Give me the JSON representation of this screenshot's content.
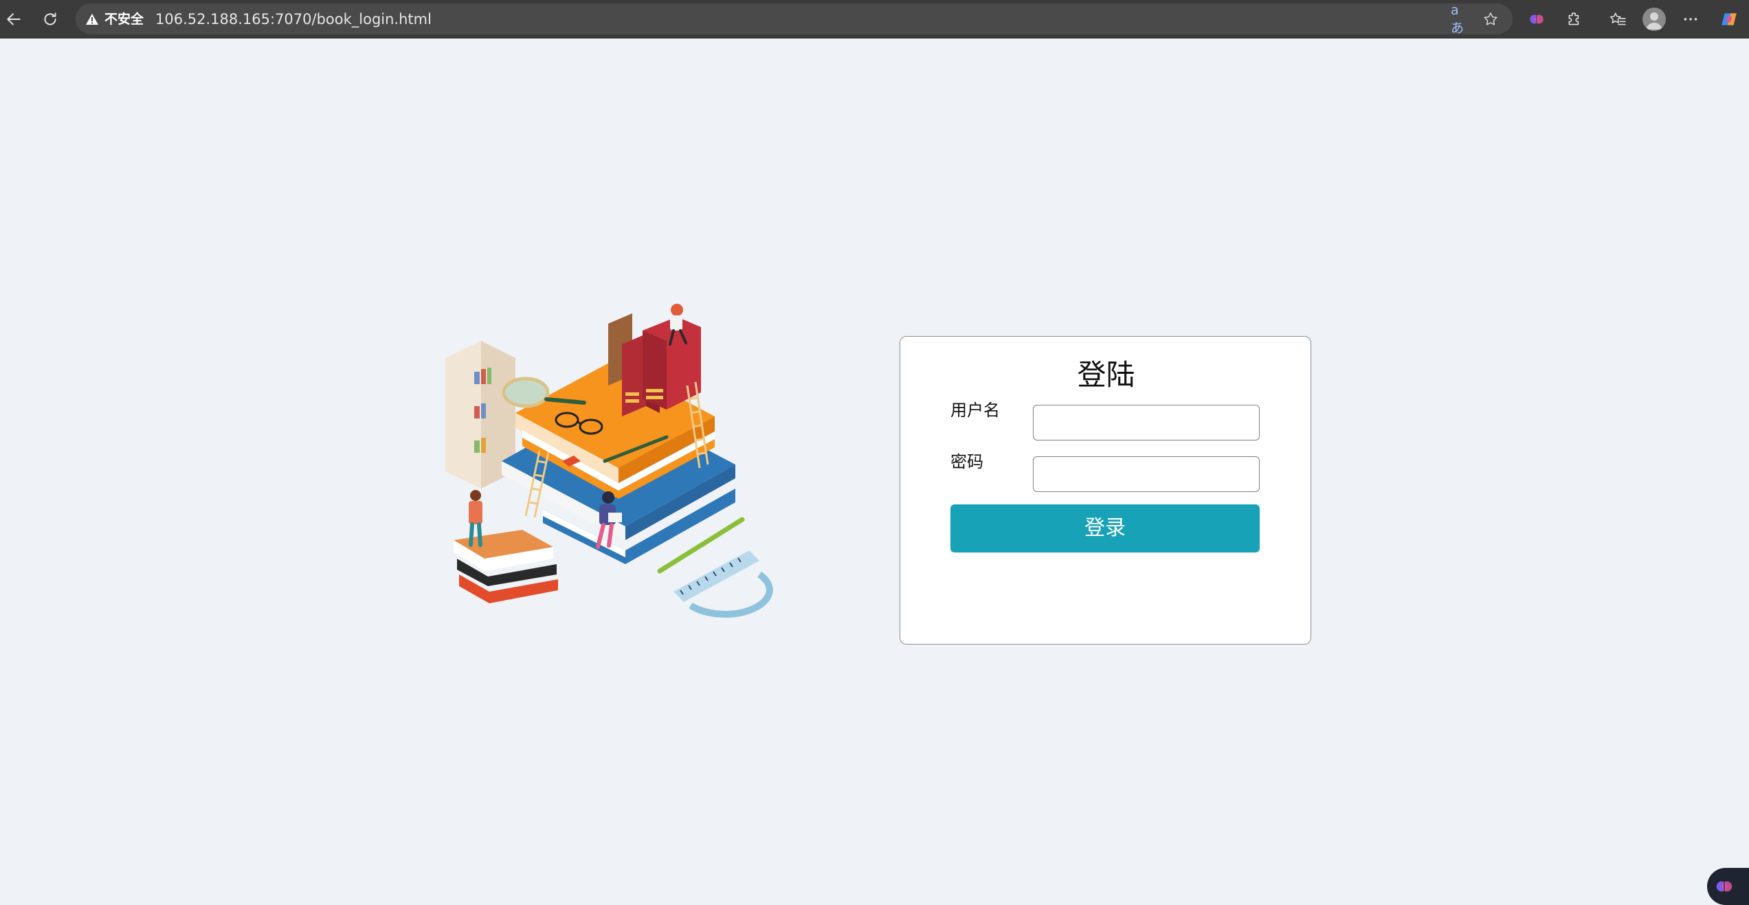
{
  "browser": {
    "back_icon": "back-arrow-icon",
    "reload_icon": "reload-icon",
    "security_label": "不安全",
    "url": "106.52.188.165:7070/book_login.html",
    "read_aloud_label": "aあ",
    "toolbar_icons": [
      "translate-icon",
      "star-icon",
      "copilot-icon",
      "extensions-icon",
      "favorites-icon",
      "profile-avatar",
      "more-icon",
      "copilot-app-icon"
    ]
  },
  "login": {
    "title": "登陆",
    "username_label": "用户名",
    "username_value": "",
    "password_label": "密码",
    "password_value": "",
    "submit_label": "登录",
    "accent_color": "#17a2b8"
  },
  "illustration": {
    "description_icon": "books-reading-illustration"
  }
}
